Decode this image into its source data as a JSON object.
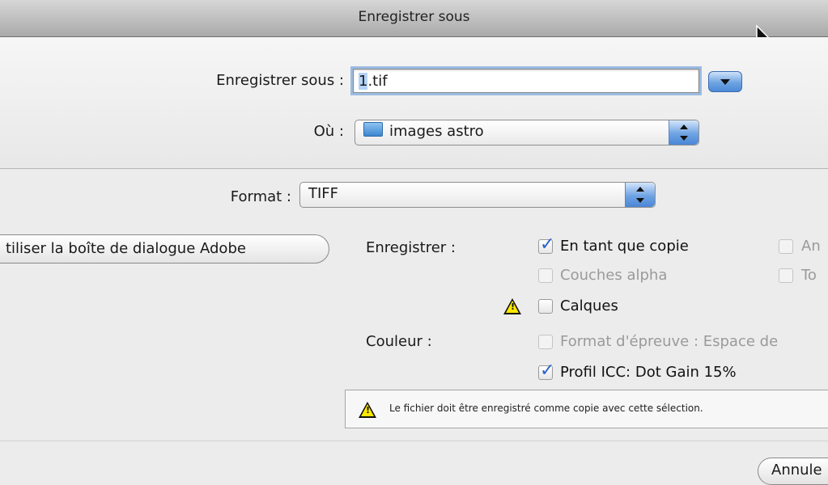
{
  "window": {
    "title": "Enregistrer sous"
  },
  "save_as": {
    "label": "Enregistrer sous :",
    "value_selected": "1",
    "value_rest": ".tif"
  },
  "where": {
    "label": "Où :",
    "value": "images astro"
  },
  "format": {
    "label": "Format :",
    "value": "TIFF"
  },
  "adobe_dialog_button": "tiliser la boîte de dialogue Adobe",
  "save_section": {
    "label": "Enregistrer :",
    "options": {
      "as_copy": {
        "label": "En tant que copie",
        "checked": true,
        "enabled": true
      },
      "alpha": {
        "label": "Couches alpha",
        "checked": false,
        "enabled": false
      },
      "layers": {
        "label": "Calques",
        "checked": false,
        "enabled": true
      },
      "annotations": {
        "label": "An",
        "checked": false,
        "enabled": false
      },
      "spot": {
        "label": "To",
        "checked": false,
        "enabled": false
      }
    }
  },
  "color_section": {
    "label": "Couleur :",
    "options": {
      "proof": {
        "label": "Format d'épreuve : Espace de",
        "checked": false,
        "enabled": false
      },
      "icc": {
        "label": "Profil ICC:  Dot Gain 15%",
        "checked": true,
        "enabled": true
      }
    }
  },
  "notice": "Le fichier doit être enregistré comme copie avec cette sélection.",
  "cancel_button": "Annule",
  "colors": {
    "accent": "#4c8ad8",
    "warning": "#ffe800"
  }
}
